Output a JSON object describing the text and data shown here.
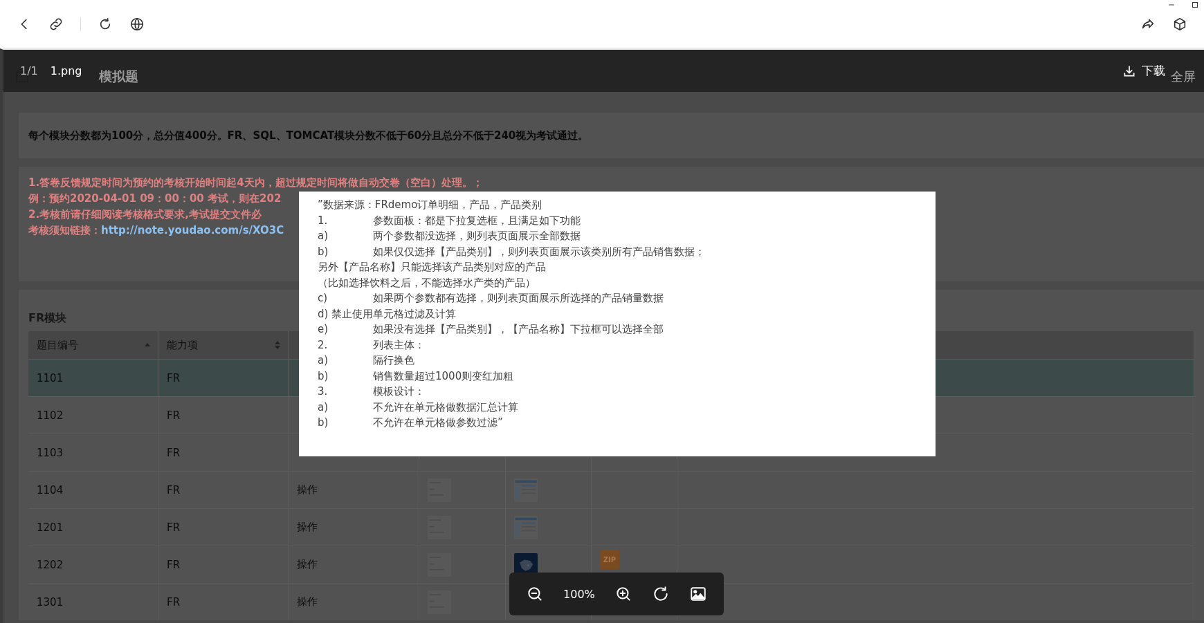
{
  "page": {
    "title_parts": [
      "模拟题"
    ],
    "fullscreen_label": "全屏",
    "notice": "每个模块分数都为100分，总分值400分。FR、SQL、TOMCAT模块分数不低于60分且总分不低于240视为考试通过。",
    "rules": [
      "1.答卷反馈规定时间为预约的考核开始时间起4天内，超过规定时间将做自动交卷（空白）处理。；",
      "例：预约2020-04-01 09：00：00 考试，则在202",
      "2.考核前请仔细阅读考核格式要求,考试提交文件必"
    ],
    "link_label": "考核须知链接：",
    "link": "http://note.youdao.com/s/XO3C",
    "section_title": "FR模块",
    "table": {
      "columns": [
        {
          "label": "题目编号",
          "kind": "sorted"
        },
        {
          "label": "能力项",
          "kind": "sortable"
        }
      ],
      "rows": [
        {
          "id": "1101",
          "ability": "FR",
          "selected": true
        },
        {
          "id": "1102",
          "ability": "FR",
          "selected": false
        },
        {
          "id": "1103",
          "ability": "FR",
          "selected": false
        },
        {
          "id": "1104",
          "ability": "FR",
          "type": "操作",
          "selected": false
        },
        {
          "id": "1201",
          "ability": "FR",
          "type": "操作",
          "selected": false
        },
        {
          "id": "1202",
          "ability": "FR",
          "type": "操作",
          "file": "ZIP",
          "selected": false
        },
        {
          "id": "1301",
          "ability": "FR",
          "type": "操作",
          "selected": false
        }
      ]
    }
  },
  "viewer": {
    "counter": "1/1",
    "filename": "1.png",
    "download": "下载",
    "zoom": "100%",
    "image_lines": [
      {
        "text": "”数据来源：FRdemo订单明细，产品，产品类别"
      },
      {
        "marker": "1.",
        "text": "参数面板：都是下拉复选框，且满足如下功能"
      },
      {
        "marker": "a)",
        "text": "两个参数都没选择，则列表页面展示全部数据"
      },
      {
        "marker": "b)",
        "text": "如果仅仅选择【产品类别】，则列表页面展示该类别所有产品销售数据；"
      },
      {
        "text": "另外【产品名称】只能选择该产品类别对应的产品"
      },
      {
        "text": "（比如选择饮料之后，不能选择水产类的产品）"
      },
      {
        "marker": "c)",
        "text": "如果两个参数都有选择，则列表页面展示所选择的产品销量数据"
      },
      {
        "text": "d) 禁止使用单元格过滤及计算"
      },
      {
        "marker": "e)",
        "text": "如果没有选择【产品类别】，【产品名称】下拉框可以选择全部"
      },
      {
        "marker": "2.",
        "text": "列表主体："
      },
      {
        "marker": "a)",
        "text": "隔行换色"
      },
      {
        "marker": "b)",
        "text": "销售数量超过1000则变红加粗"
      },
      {
        "marker": "3.",
        "text": "模板设计："
      },
      {
        "marker": "a)",
        "text": "不允许在单元格做数据汇总计算"
      },
      {
        "marker": "b)",
        "text": "不允许在单元格做参数过滤”"
      }
    ]
  }
}
